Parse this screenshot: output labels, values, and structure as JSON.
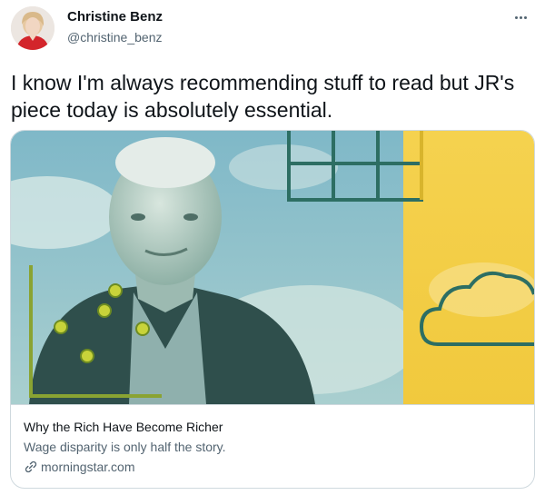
{
  "author": {
    "name": "Christine Benz",
    "handle": "@christine_benz"
  },
  "tweet": {
    "text": "I know I'm always recommending stuff to read but JR's\npiece today is absolutely essential."
  },
  "card": {
    "title": "Why the Rich Have Become Richer",
    "description": "Wage disparity is only half the story.",
    "domain": "morningstar.com"
  },
  "icons": {
    "more": "more-horizontal-icon",
    "link": "link-icon"
  },
  "colors": {
    "text_primary": "#0f1419",
    "text_secondary": "#536471",
    "border": "#cfd9de",
    "image_teal": "#2f6f70",
    "image_yellow": "#f3cf45",
    "image_green_line": "#7aa33a"
  }
}
